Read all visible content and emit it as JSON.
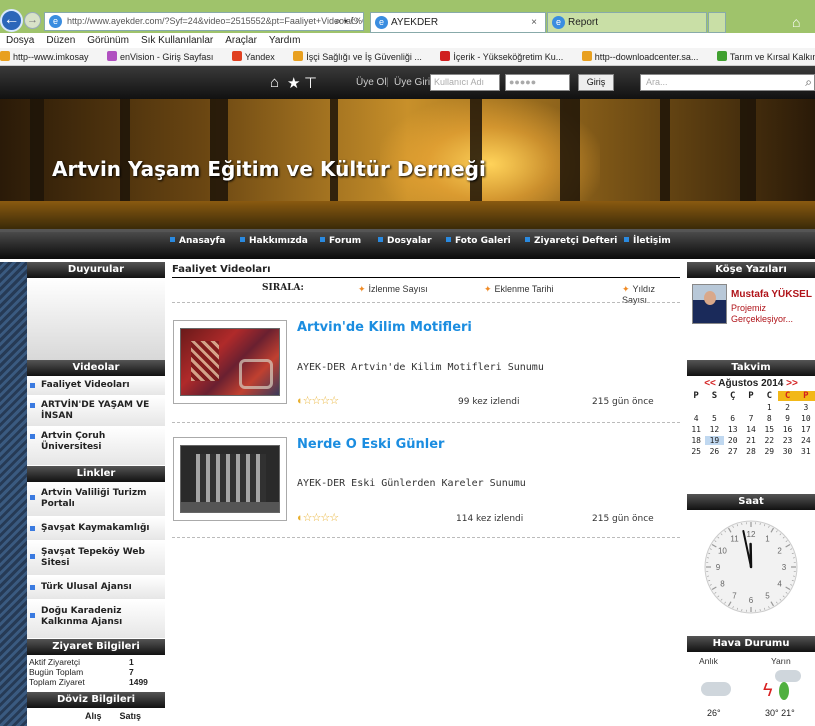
{
  "browser": {
    "address": "http://www.ayekder.com/?Syf=24&video=2515552&pt=Faaliyet+Videolar%C4%",
    "address_domain": "ayekder.com",
    "tabs": [
      {
        "label": "AYEKDER"
      },
      {
        "label": "Report"
      }
    ],
    "menu": [
      "Dosya",
      "Düzen",
      "Görünüm",
      "Sık Kullanılanlar",
      "Araçlar",
      "Yardım"
    ],
    "favorites": [
      "http--www.imkosay",
      "enVision - Giriş Sayfası",
      "Yandex",
      "İşçi Sağlığı ve İş Güvenliği ...",
      "İçerik - Yükseköğretim Ku...",
      "http--downloadcenter.sa...",
      "Tarım ve Kırsal Kalkınmayı..."
    ]
  },
  "topnav": {
    "signup": "Üye Ol",
    "login": "Üye Girişi",
    "username_placeholder": "Kullanıcı Adı",
    "password_placeholder": "●●●●●",
    "login_button": "Giriş",
    "search_placeholder": "Ara..."
  },
  "banner": {
    "title": "Artvin Yaşam Eğitim ve Kültür Derneği"
  },
  "mainnav": [
    "Anasayfa",
    "Hakkımızda",
    "Forum",
    "Dosyalar",
    "Foto Galeri",
    "Ziyaretçi Defteri",
    "İletişim"
  ],
  "left": {
    "announcements_head": "Duyurular",
    "videos_head": "Videolar",
    "videos": [
      "Faaliyet Videoları",
      "ARTVİN'DE YAŞAM VE İNSAN",
      "Artvin Çoruh Üniversitesi"
    ],
    "links_head": "Linkler",
    "links": [
      "Artvin Valiliği Turizm Portalı",
      "Şavşat Kaymakamlığı",
      "Şavşat Tepeköy Web Sitesi",
      "Türk Ulusal Ajansı",
      "Doğu Karadeniz Kalkınma Ajansı"
    ],
    "visit_head": "Ziyaret Bilgileri",
    "visits": [
      {
        "label": "Aktif Ziyaretçi",
        "value": "1"
      },
      {
        "label": "Bugün Toplam",
        "value": "7"
      },
      {
        "label": "Toplam Ziyaret",
        "value": "1499"
      }
    ],
    "currency_head": "Döviz Bilgileri",
    "currency_buy": "Alış",
    "currency_sell": "Satış"
  },
  "content": {
    "title": "Faaliyet Videoları",
    "sort_label": "SIRALA:",
    "sort_options": [
      "İzlenme Sayısı",
      "Eklenme Tarihi",
      "Yıldız Sayısı"
    ],
    "videos": [
      {
        "title": "Artvin'de Kilim Motifleri",
        "desc": "AYEK-DER Artvin'de Kilim Motifleri Sunumu",
        "views": "99 kez izlendi",
        "age": "215 gün önce",
        "rating": 0
      },
      {
        "title": "Nerde O Eski Günler",
        "desc": "AYEK-DER Eski Günlerden Kareler Sunumu",
        "views": "114 kez izlendi",
        "age": "215 gün önce",
        "rating": 0
      }
    ]
  },
  "right": {
    "column_head": "Köşe Yazıları",
    "author": "Mustafa YÜKSEL",
    "post": "Projemiz Gerçekleşiyor...",
    "calendar_head": "Takvim",
    "month": "Ağustos 2014",
    "prev": "<<",
    "next": ">>",
    "weekdays": [
      "P",
      "S",
      "Ç",
      "P",
      "C",
      "C",
      "P"
    ],
    "days": [
      [
        "",
        "",
        "",
        "",
        "1",
        "2",
        "3"
      ],
      [
        "4",
        "5",
        "6",
        "7",
        "8",
        "9",
        "10"
      ],
      [
        "11",
        "12",
        "13",
        "14",
        "15",
        "16",
        "17"
      ],
      [
        "18",
        "19",
        "20",
        "21",
        "22",
        "23",
        "24"
      ],
      [
        "25",
        "26",
        "27",
        "28",
        "29",
        "30",
        "31"
      ]
    ],
    "today": "19",
    "clock_head": "Saat",
    "clock_time": {
      "hour": 11,
      "minute": 58
    },
    "clock_numbers": [
      "12",
      "1",
      "2",
      "3",
      "4",
      "5",
      "6",
      "7",
      "8",
      "9",
      "10",
      "11"
    ],
    "weather_head": "Hava Durumu",
    "weather_now": "Anlık",
    "weather_tomorrow": "Yarın",
    "temp_now": "26°",
    "temp_tomorrow": "30° 21°"
  },
  "colors": {
    "accent": "#1b8de0",
    "nav_bg": "#111111",
    "weekend": "#f2b818",
    "author": "#b0141a"
  }
}
